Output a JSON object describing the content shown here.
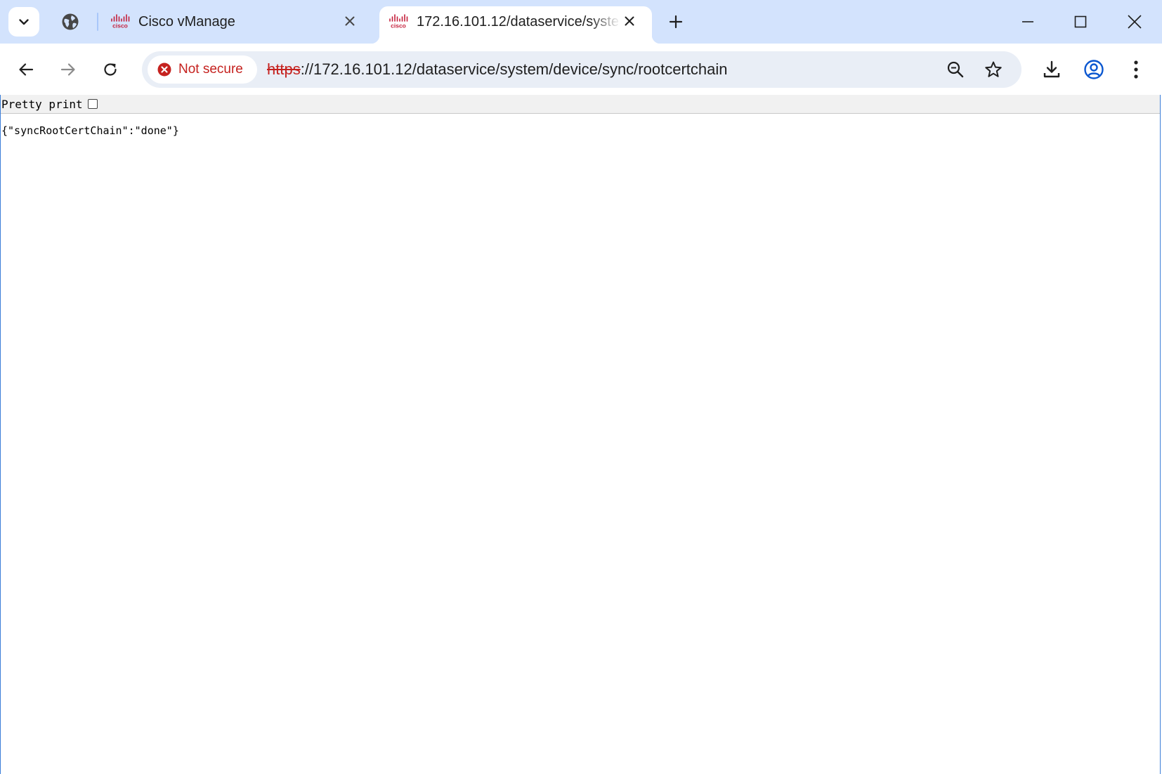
{
  "tabs": [
    {
      "title": "Cisco vManage",
      "icon": "cisco-logo-icon",
      "active": false
    },
    {
      "title": "172.16.101.12/dataservice/system/device/sync/rootcertchain",
      "icon": "cisco-logo-icon",
      "active": true
    }
  ],
  "toolbar": {
    "security_label": "Not secure",
    "url_scheme": "https",
    "url_rest": "://172.16.101.12/dataservice/system/device/sync/rootcertchain"
  },
  "page": {
    "pretty_print_label": "Pretty print",
    "pretty_print_checked": false,
    "json_text": "{\"syncRootCertChain\":\"done\"}"
  },
  "colors": {
    "tabstrip_bg": "#d3e3fd",
    "omnibox_bg": "#e9eef6",
    "insecure_red": "#c5221f",
    "cisco_red": "#c41e3a"
  }
}
